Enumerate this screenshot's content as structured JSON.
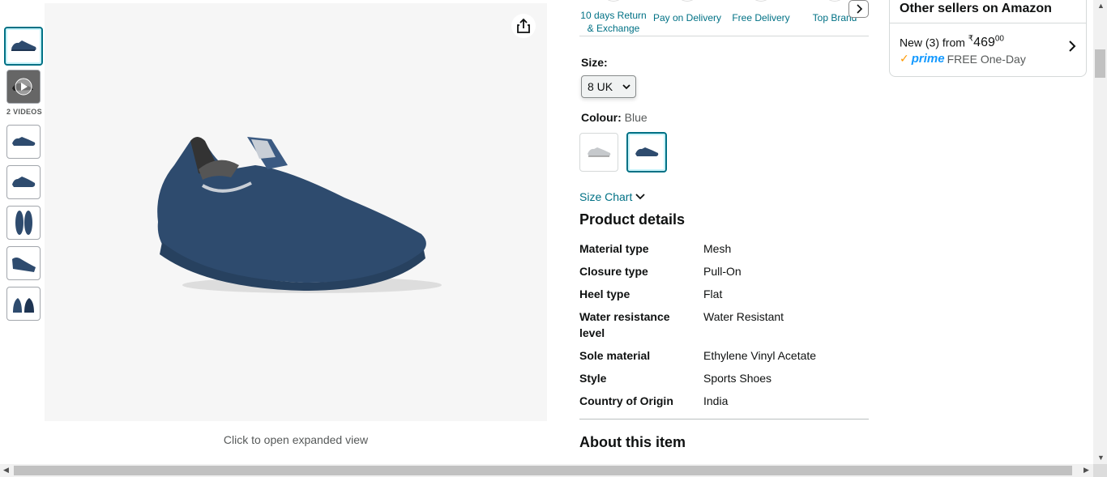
{
  "thumbnails": {
    "videos_label": "2 VIDEOS"
  },
  "main_image": {
    "caption": "Click to open expanded view"
  },
  "features": [
    "10 days Return & Exchange",
    "Pay on Delivery",
    "Free Delivery",
    "Top Brand"
  ],
  "size": {
    "label": "Size:",
    "selected": "8 UK"
  },
  "colour": {
    "label": "Colour:",
    "value": "Blue",
    "swatches": [
      "grey",
      "blue"
    ]
  },
  "size_chart": "Size Chart",
  "product_details": {
    "title": "Product details",
    "rows": [
      {
        "key": "Material type",
        "value": "Mesh"
      },
      {
        "key": "Closure type",
        "value": "Pull-On"
      },
      {
        "key": "Heel type",
        "value": "Flat"
      },
      {
        "key": "Water resistance level",
        "value": "Water Resistant"
      },
      {
        "key": "Sole material",
        "value": "Ethylene Vinyl Acetate"
      },
      {
        "key": "Style",
        "value": "Sports Shoes"
      },
      {
        "key": "Country of Origin",
        "value": "India"
      }
    ]
  },
  "about": "About this item",
  "sellers": {
    "title": "Other sellers on Amazon",
    "new_prefix": "New (3) from",
    "currency": "₹",
    "price_whole": "469",
    "price_fraction": "00",
    "prime": "prime",
    "shipping": "FREE One-Day"
  },
  "colors": {
    "accent": "#007185",
    "shoe_blue": "#2e4b6e",
    "prime_blue": "#1399ff",
    "prime_orange": "#ff9900"
  }
}
